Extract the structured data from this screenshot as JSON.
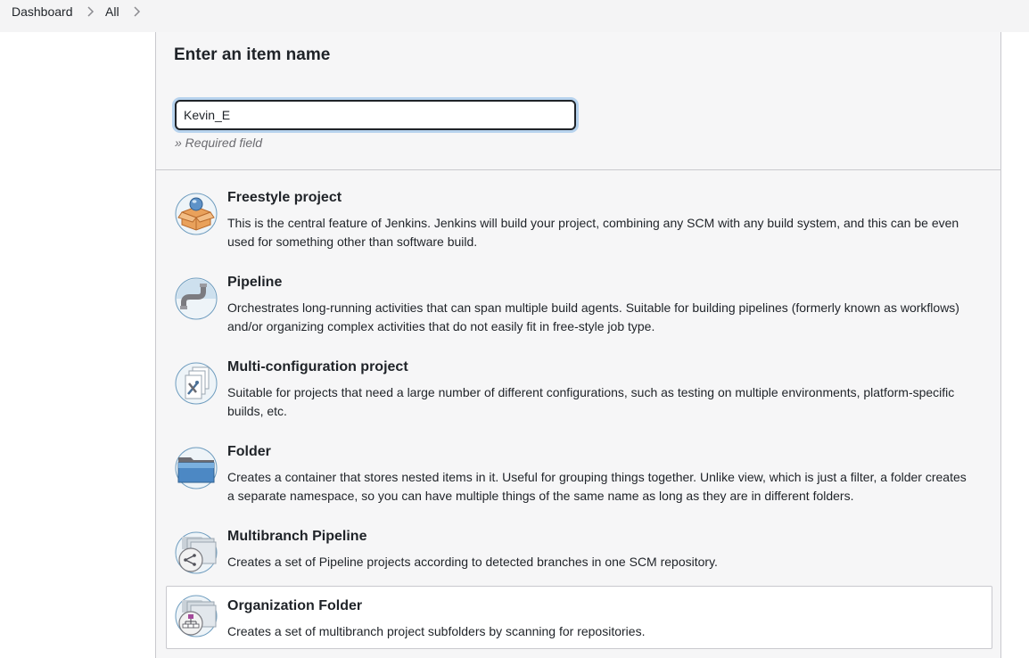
{
  "breadcrumb": {
    "items": [
      {
        "label": "Dashboard"
      },
      {
        "label": "All"
      }
    ]
  },
  "form": {
    "heading": "Enter an item name",
    "item_name_value": "Kevin_E",
    "required_note": "» Required field"
  },
  "item_types": [
    {
      "title": "Freestyle project",
      "description": "This is the central feature of Jenkins. Jenkins will build your project, combining any SCM with any build system, and this can be even used for something other than software build.",
      "icon": "freestyle-project-icon"
    },
    {
      "title": "Pipeline",
      "description": "Orchestrates long-running activities that can span multiple build agents. Suitable for building pipelines (formerly known as workflows) and/or organizing complex activities that do not easily fit in free-style job type.",
      "icon": "pipeline-icon"
    },
    {
      "title": "Multi-configuration project",
      "description": "Suitable for projects that need a large number of different configurations, such as testing on multiple environments, platform-specific builds, etc.",
      "icon": "multi-configuration-icon"
    },
    {
      "title": "Folder",
      "description": "Creates a container that stores nested items in it. Useful for grouping things together. Unlike view, which is just a filter, a folder creates a separate namespace, so you can have multiple things of the same name as long as they are in different folders.",
      "icon": "folder-icon"
    },
    {
      "title": "Multibranch Pipeline",
      "description": "Creates a set of Pipeline projects according to detected branches in one SCM repository.",
      "icon": "multibranch-pipeline-icon"
    },
    {
      "title": "Organization Folder",
      "description": "Creates a set of multibranch project subfolders by scanning for repositories.",
      "icon": "organization-folder-icon"
    }
  ],
  "colors": {
    "panel_background": "#f6f6f7",
    "breadcrumb_background": "#f4f4f5",
    "input_focus_ring": "#b7d3ee"
  }
}
